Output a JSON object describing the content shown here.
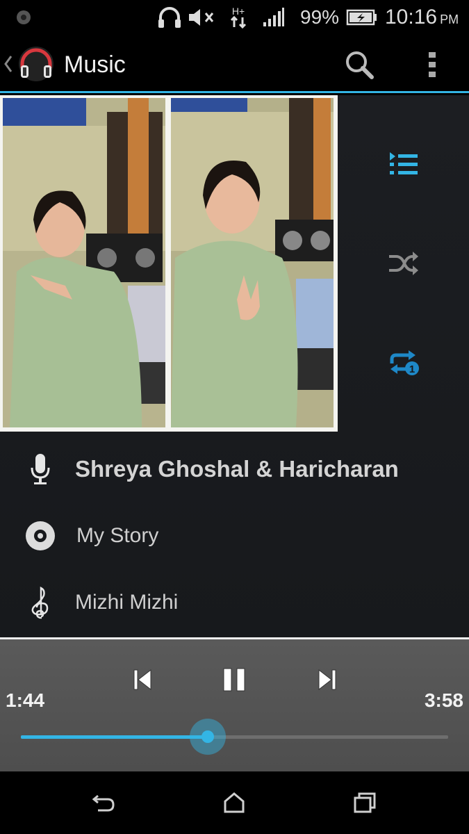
{
  "status_bar": {
    "icons": [
      "notification-dot-icon",
      "headset-icon",
      "mute-icon",
      "hplus-data-icon",
      "signal-icon",
      "battery-charging-icon"
    ],
    "network": "H+",
    "battery": "99%",
    "time": "10:16",
    "ampm": "PM"
  },
  "action_bar": {
    "title": "Music",
    "icons": [
      "back-chevron-icon",
      "headphones-app-icon",
      "search-icon",
      "overflow-menu-icon"
    ]
  },
  "side_controls": {
    "icons": [
      "playlist-icon",
      "shuffle-icon",
      "repeat-one-icon"
    ],
    "playlist_color": "#33b5e5",
    "shuffle_color": "#8c8c8c",
    "repeat_color": "#1e88c7"
  },
  "track": {
    "artist": "Shreya Ghoshal & Haricharan",
    "album": "My Story",
    "title": "Mizhi Mizhi",
    "icons": [
      "microphone-icon",
      "album-disc-icon",
      "treble-clef-icon"
    ]
  },
  "player": {
    "elapsed": "1:44",
    "duration": "3:58",
    "progress_fraction": 0.437,
    "icons": [
      "previous-icon",
      "pause-icon",
      "next-icon"
    ],
    "accent": "#33b5e5"
  },
  "nav_bar": {
    "icons": [
      "back-icon",
      "home-icon",
      "recents-icon"
    ]
  }
}
